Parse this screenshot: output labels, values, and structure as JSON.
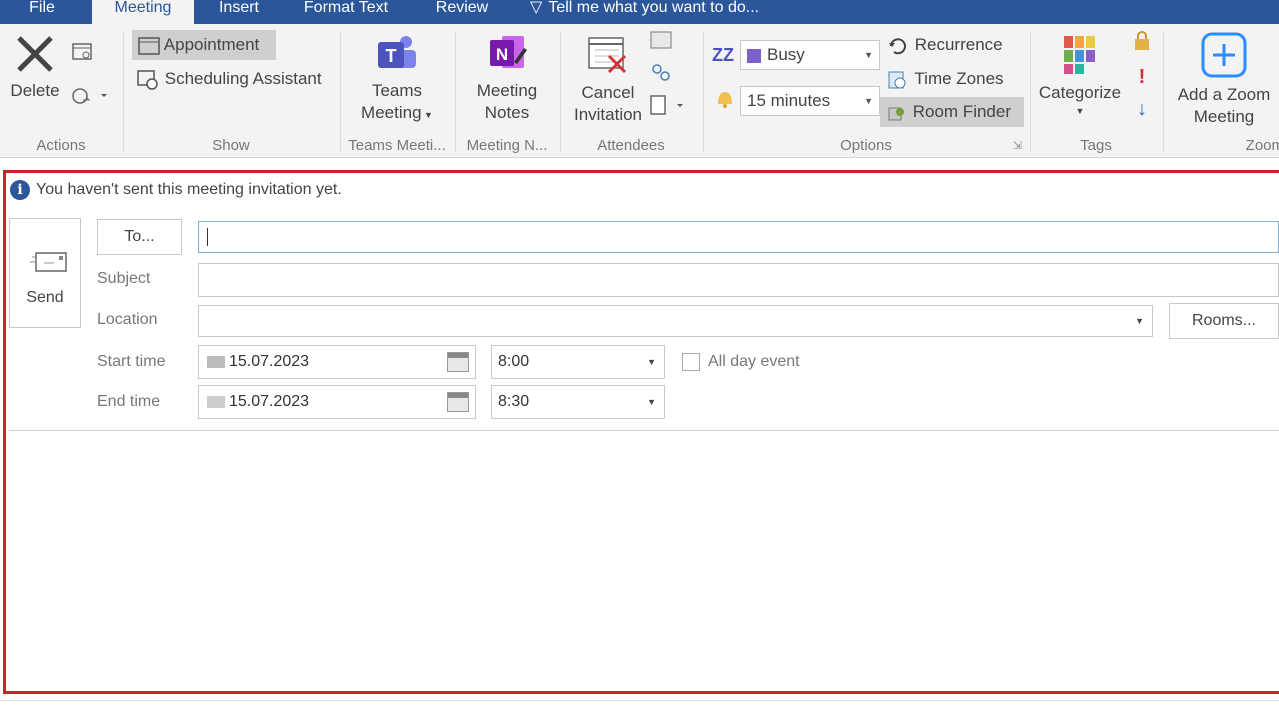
{
  "tabs": {
    "file": "File",
    "meeting": "Meeting",
    "insert": "Insert",
    "format_text": "Format Text",
    "review": "Review",
    "tell_me": "Tell me what you want to do..."
  },
  "ribbon": {
    "actions": {
      "label": "Actions",
      "delete": "Delete"
    },
    "show": {
      "label": "Show",
      "appointment": "Appointment",
      "scheduling_assistant": "Scheduling Assistant"
    },
    "teams": {
      "label": "Teams Meeti...",
      "button_line1": "Teams",
      "button_line2": "Meeting"
    },
    "meeting_notes": {
      "label": "Meeting N...",
      "button_line1": "Meeting",
      "button_line2": "Notes"
    },
    "attendees": {
      "label": "Attendees",
      "cancel_line1": "Cancel",
      "cancel_line2": "Invitation"
    },
    "options": {
      "label": "Options",
      "show_as": "Busy",
      "reminder": "15 minutes",
      "recurrence": "Recurrence",
      "time_zones": "Time Zones",
      "room_finder": "Room Finder"
    },
    "tags": {
      "label": "Tags",
      "categorize": "Categorize"
    },
    "zoom": {
      "label": "Zoom",
      "button_line1": "Add a Zoom",
      "button_line2": "Meeting"
    }
  },
  "form": {
    "info_message": "You haven't sent this meeting invitation yet.",
    "send": "Send",
    "to_button": "To...",
    "to_value": "",
    "subject_label": "Subject",
    "subject_value": "",
    "location_label": "Location",
    "location_value": "",
    "rooms_button": "Rooms...",
    "start_time_label": "Start time",
    "start_date": "15.07.2023",
    "start_time": "8:00",
    "end_time_label": "End time",
    "end_date": "15.07.2023",
    "end_time": "8:30",
    "all_day_label": "All day event",
    "all_day_checked": false
  },
  "colors": {
    "accent": "#2b579a",
    "highlight_frame": "#d0202a",
    "ribbon_bg": "#f3f3f3"
  }
}
